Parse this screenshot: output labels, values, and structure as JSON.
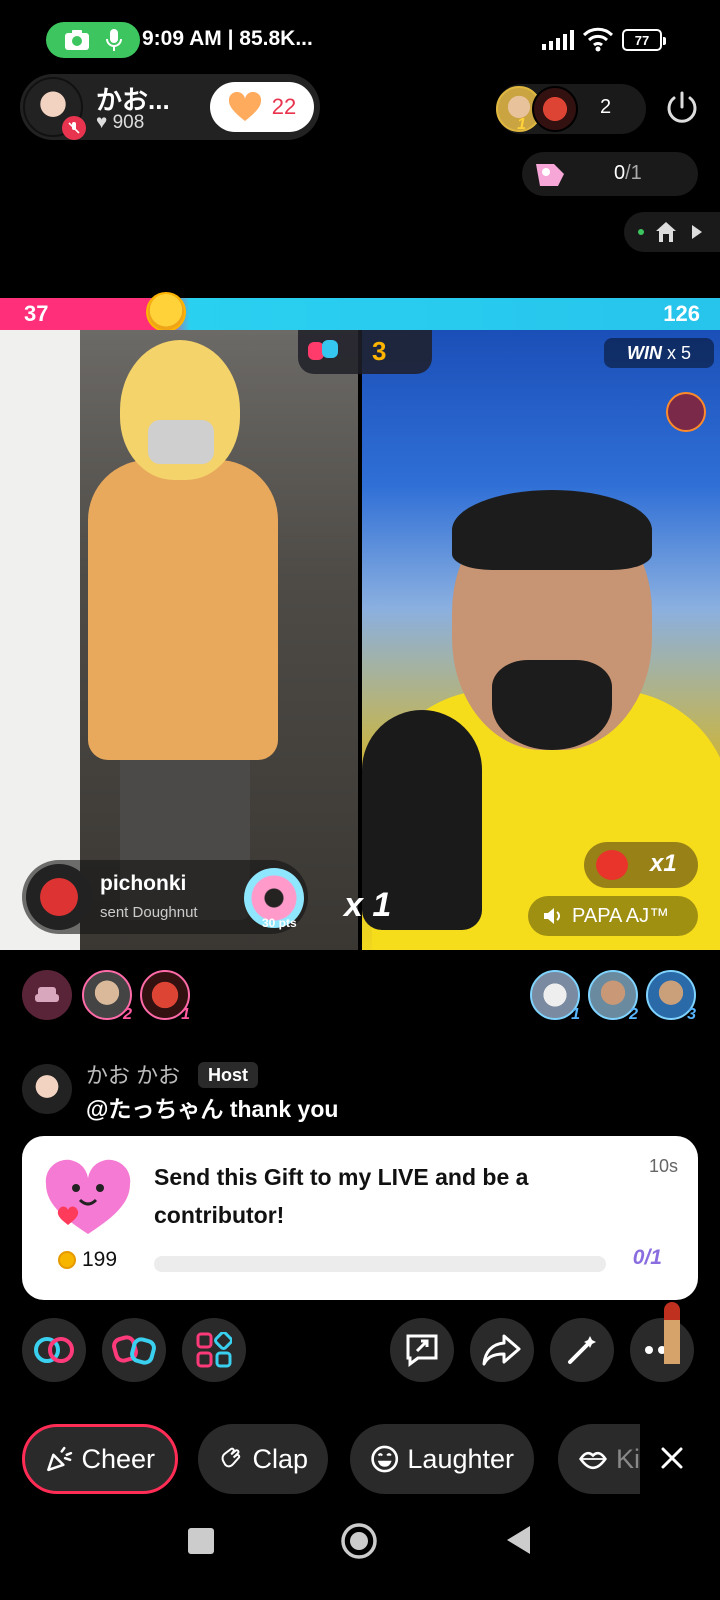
{
  "status_bar": {
    "time_title": "9:09 AM | 85.8K...",
    "battery": "77",
    "icons": [
      "camera-icon",
      "mic-icon",
      "signal-icon",
      "wifi-icon",
      "battery-icon"
    ]
  },
  "host": {
    "name": "かお...",
    "likes": "908",
    "heart_count": "22"
  },
  "viewers": {
    "count": "2",
    "ranks": [
      "1",
      ""
    ]
  },
  "gift_goal": {
    "current": "0",
    "total": "/1"
  },
  "battle": {
    "score_left": "37",
    "score_right": "126",
    "streak": "3",
    "win_label": "WIN",
    "win_multiplier": "x 5"
  },
  "gift_toast": {
    "sender": "pichonki",
    "action": "sent Doughnut",
    "points": "30 pts",
    "combo": "x 1"
  },
  "right_panel": {
    "boost_multiplier": "x1",
    "guest_name": "PAPA AJ™"
  },
  "contributors_left": [
    {
      "rank": "2"
    },
    {
      "rank": "1"
    }
  ],
  "contributors_right": [
    {
      "rank": "1"
    },
    {
      "rank": "2"
    },
    {
      "rank": "3"
    }
  ],
  "chat": {
    "user": "かお かお",
    "tag": "Host",
    "message": "@たっちゃん thank you"
  },
  "gift_card": {
    "title": "Send this Gift to my LIVE and be a contributor!",
    "timer": "10s",
    "coins": "199",
    "progress": "0/1",
    "progress_fraction": 0
  },
  "reactions": [
    {
      "label": "Cheer",
      "icon": "cheer-icon",
      "active": true
    },
    {
      "label": "Clap",
      "icon": "clap-icon",
      "active": false
    },
    {
      "label": "Laughter",
      "icon": "laughter-icon",
      "active": false
    },
    {
      "label": "Ki",
      "icon": "kiss-icon",
      "active": false
    }
  ],
  "colors": {
    "accent_pink": "#ff2f7a",
    "accent_blue": "#27c4ec",
    "active_red": "#ff2c55",
    "progress_purple": "#8a6ee0"
  }
}
